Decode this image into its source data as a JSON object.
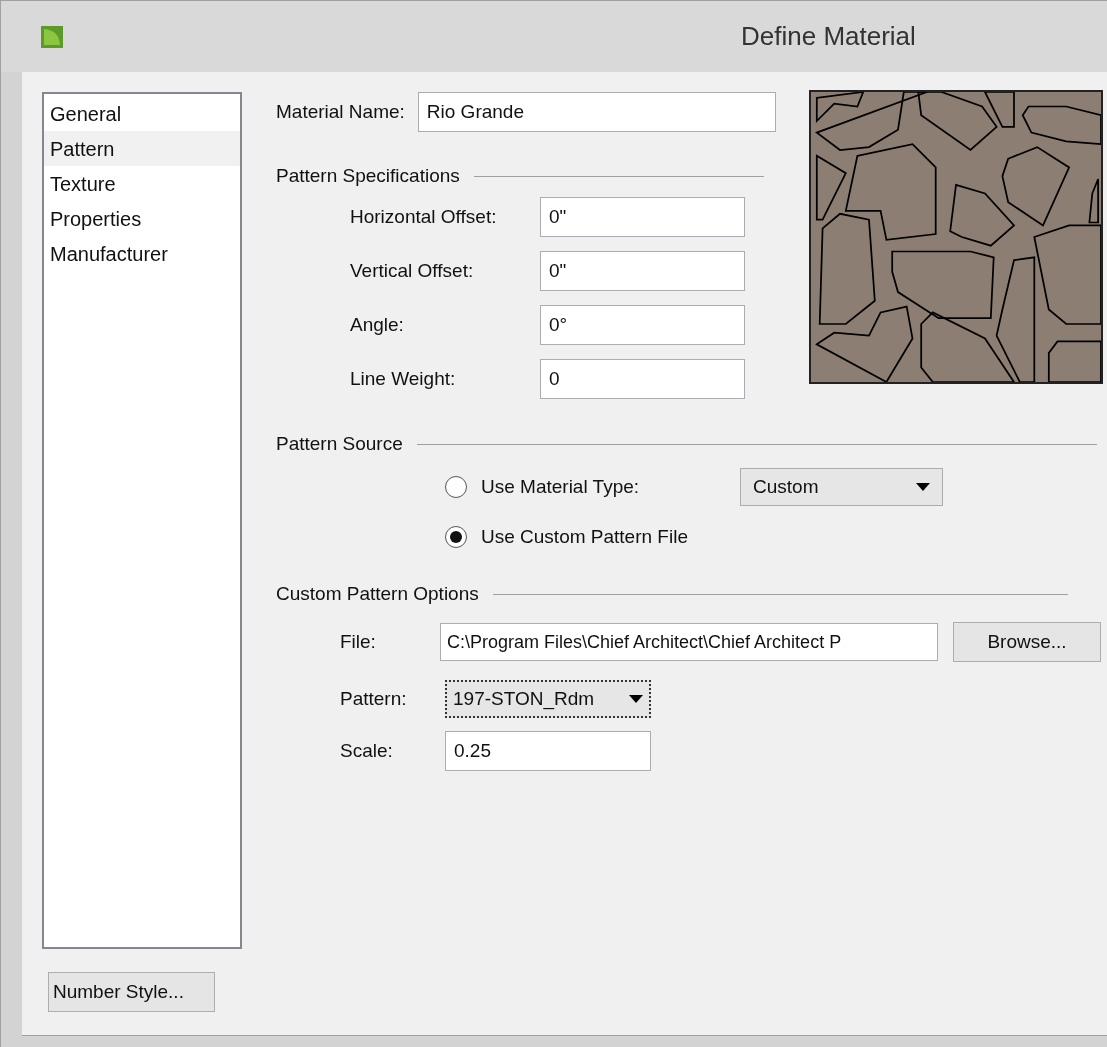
{
  "window": {
    "title": "Define Material"
  },
  "sidebar": {
    "items": [
      {
        "label": "General",
        "selected": false
      },
      {
        "label": "Pattern",
        "selected": true
      },
      {
        "label": "Texture",
        "selected": false
      },
      {
        "label": "Properties",
        "selected": false
      },
      {
        "label": "Manufacturer",
        "selected": false
      }
    ],
    "button": "Number Style..."
  },
  "material_name": {
    "label": "Material Name:",
    "value": "Rio Grande"
  },
  "pattern_specifications": {
    "heading": "Pattern Specifications",
    "fields": [
      {
        "label": "Horizontal Offset:",
        "value": "0\""
      },
      {
        "label": "Vertical Offset:",
        "value": "0\""
      },
      {
        "label": "Angle:",
        "value": "0°"
      },
      {
        "label": "Line Weight:",
        "value": "0"
      }
    ]
  },
  "pattern_source": {
    "heading": "Pattern Source",
    "options": [
      {
        "label": "Use Material Type:",
        "selected": false
      },
      {
        "label": "Use Custom Pattern File",
        "selected": true
      }
    ],
    "material_type": "Custom"
  },
  "custom_pattern_options": {
    "heading": "Custom Pattern Options",
    "file": {
      "label": "File:",
      "value": "C:\\Program Files\\Chief Architect\\Chief Architect P"
    },
    "browse_button": "Browse...",
    "pattern": {
      "label": "Pattern:",
      "value": "197-STON_Rdm"
    },
    "scale": {
      "label": "Scale:",
      "value": "0.25"
    }
  }
}
